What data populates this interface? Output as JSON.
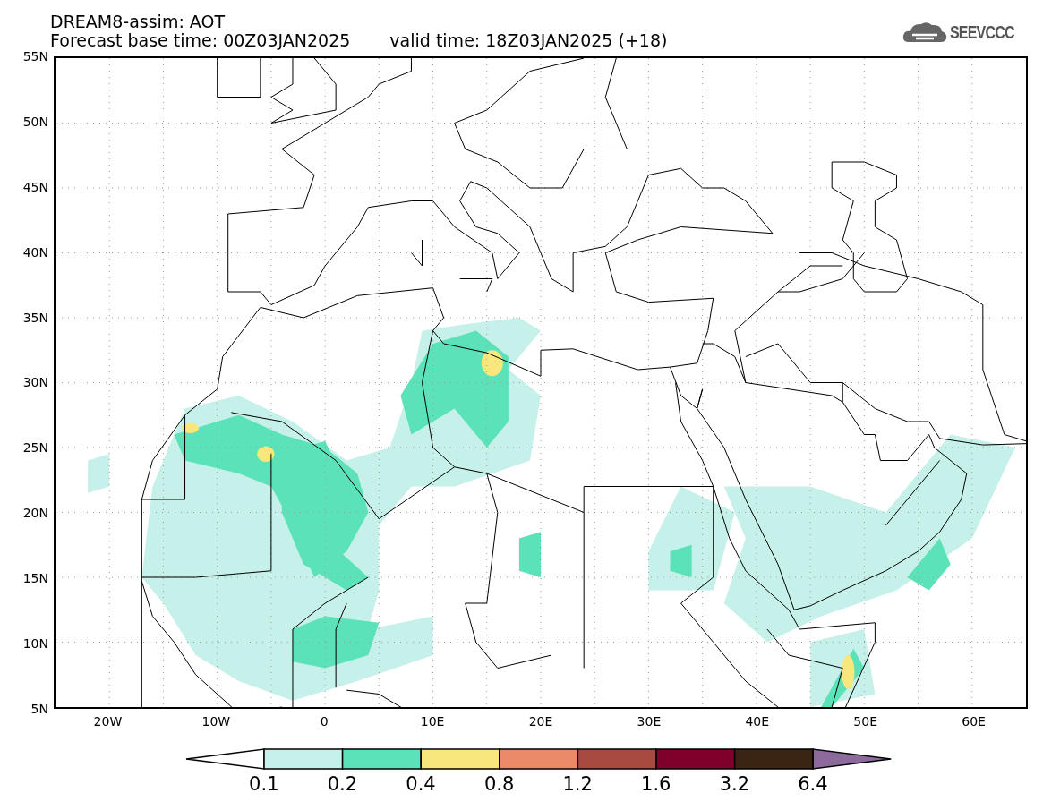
{
  "header": {
    "title": "DREAM8-assim: AOT",
    "base_time": "Forecast base time: 00Z03JAN2025",
    "valid_time": "valid time: 18Z03JAN2025 (+18)",
    "logo": "SEEVCCC"
  },
  "map": {
    "y_labels": [
      "55N",
      "50N",
      "45N",
      "40N",
      "35N",
      "30N",
      "25N",
      "20N",
      "15N",
      "10N",
      "5N"
    ],
    "x_labels": [
      "20W",
      "10W",
      "0",
      "10E",
      "20E",
      "30E",
      "40E",
      "50E",
      "60E"
    ]
  },
  "colorbar": {
    "segments": [
      {
        "kind": "arrow-left",
        "color": "#ffffff"
      },
      {
        "kind": "box",
        "color": "#c6f0ea"
      },
      {
        "kind": "box",
        "color": "#5ce2b8"
      },
      {
        "kind": "box",
        "color": "#f8e77c"
      },
      {
        "kind": "box",
        "color": "#ea8a68"
      },
      {
        "kind": "box",
        "color": "#a84a40"
      },
      {
        "kind": "box",
        "color": "#80002c"
      },
      {
        "kind": "box",
        "color": "#3a2414"
      },
      {
        "kind": "arrow-right",
        "color": "#8c6a9c"
      }
    ],
    "labels": [
      "0.1",
      "0.2",
      "0.4",
      "0.8",
      "1.2",
      "1.6",
      "3.2",
      "6.4"
    ]
  }
}
